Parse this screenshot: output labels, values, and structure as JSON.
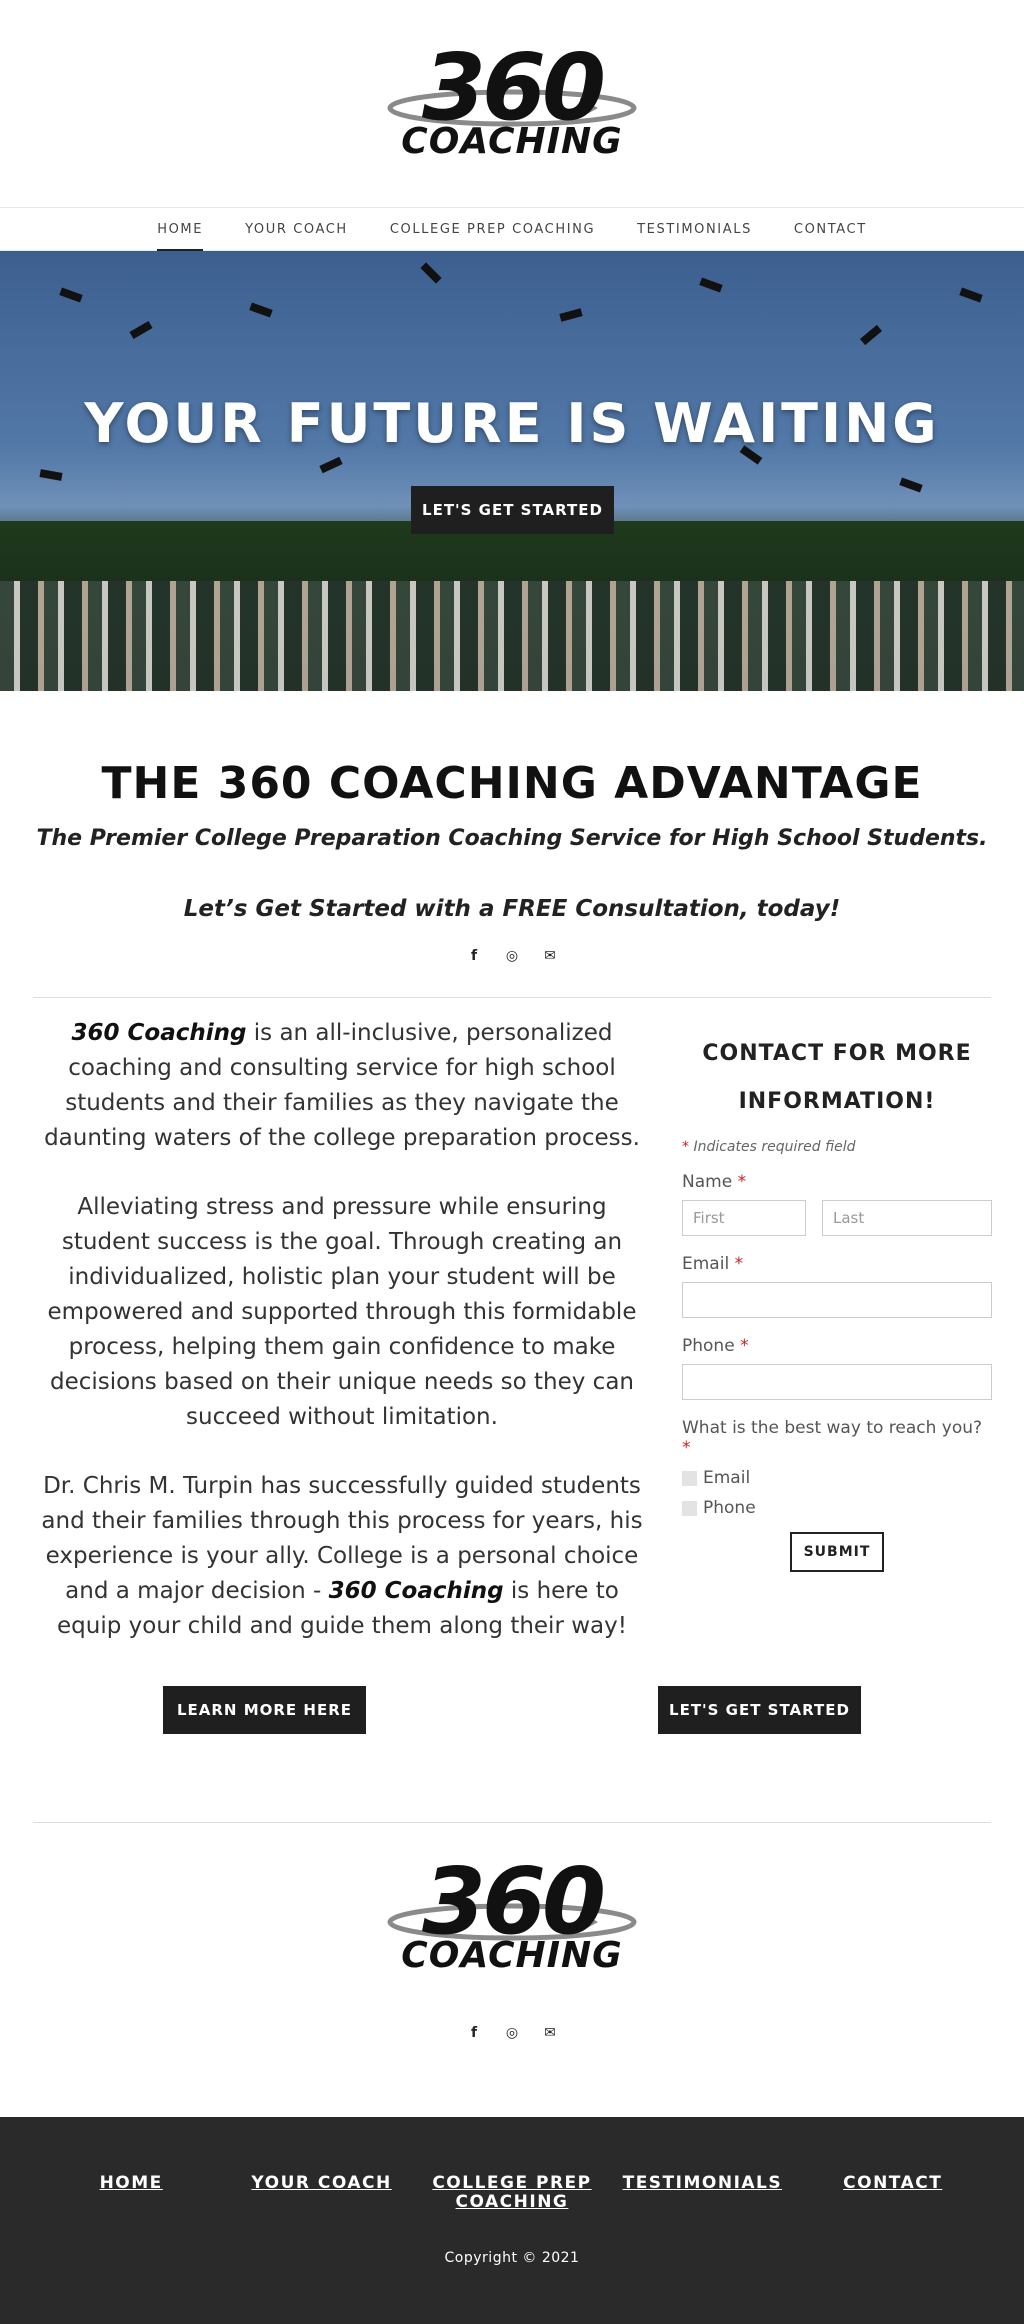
{
  "brand": {
    "logo_number": "360",
    "logo_word": "COACHING"
  },
  "nav": [
    {
      "label": "HOME",
      "active": true
    },
    {
      "label": "YOUR COACH"
    },
    {
      "label": "COLLEGE PREP COACHING"
    },
    {
      "label": "TESTIMONIALS"
    },
    {
      "label": "CONTACT"
    }
  ],
  "hero": {
    "title": "YOUR FUTURE IS WAITING",
    "button": "LET'S GET STARTED"
  },
  "advantage": {
    "title": "THE 360 COACHING ADVANTAGE",
    "subtitle": "The Premier College Preparation Coaching Service for High School Students.",
    "cta": "Let’s Get Started with a FREE Consultation, today!"
  },
  "social_icons": [
    "facebook-icon",
    "instagram-icon",
    "mail-icon"
  ],
  "about": {
    "p1_brand": "360 Coaching",
    "p1_rest": " is an all-inclusive, personalized coaching and consulting service for high school students and their families as they navigate the daunting waters of the college preparation process.",
    "p2": "Alleviating stress and pressure while ensuring student success is the goal. Through creating an individualized, holistic plan your student will be empowered and supported through this formidable process, helping them gain confidence to make decisions based on their unique needs so they can succeed without limitation.",
    "p3_start": "Dr. Chris M. Turpin has successfully guided students and their families through this process for years, his experience is your ally. College is a personal choice and a major decision - ",
    "p3_brand": "360 Coaching",
    "p3_end": " is here to equip your child and guide them along their way!"
  },
  "form": {
    "title": "CONTACT FOR MORE INFORMATION!",
    "required_note": "Indicates required field",
    "name_label": "Name",
    "first_placeholder": "First",
    "last_placeholder": "Last",
    "email_label": "Email",
    "phone_label": "Phone",
    "reach_label": "What is the best way to reach you?",
    "options": [
      "Email",
      "Phone"
    ],
    "submit": "SUBMIT"
  },
  "buttons": {
    "learn_more": "LEARN MORE HERE",
    "get_started": "LET'S GET STARTED"
  },
  "footer": {
    "links": [
      "HOME",
      "YOUR COACH",
      "COLLEGE PREP COACHING",
      "TESTIMONIALS",
      "CONTACT"
    ],
    "copyright": "Copyright © 2021"
  }
}
